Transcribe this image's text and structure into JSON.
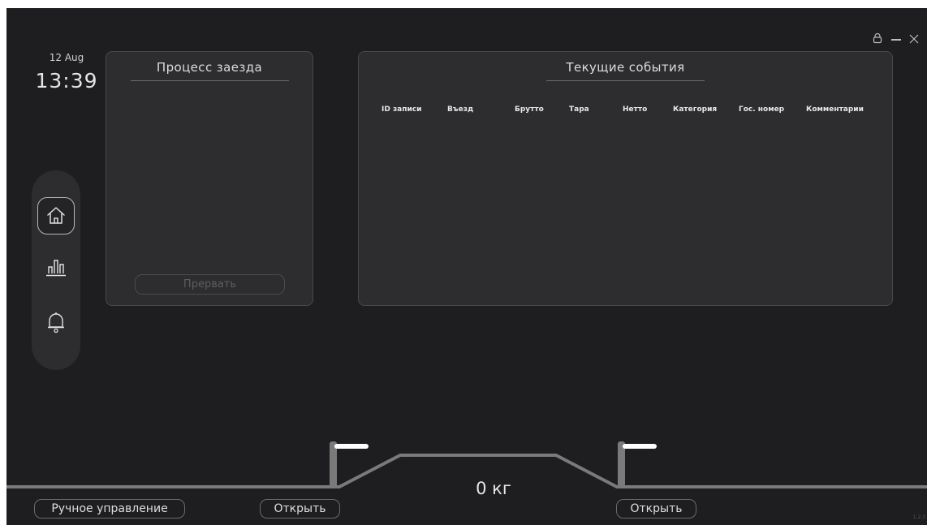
{
  "header": {
    "date": "12 Aug",
    "time": "13:39",
    "window_controls": {
      "lock_icon": "lock-icon",
      "minimize_label": "—",
      "close_label": "×"
    }
  },
  "sidebar": {
    "items": [
      {
        "id": "home",
        "icon": "home-icon",
        "active": true
      },
      {
        "id": "stats",
        "icon": "bar-chart-icon",
        "active": false
      },
      {
        "id": "notifications",
        "icon": "bell-icon",
        "active": false
      }
    ]
  },
  "process_panel": {
    "title": "Процесс заезда",
    "abort_label": "Прервать"
  },
  "events_panel": {
    "title": "Текущие события",
    "columns": [
      "ID записи",
      "Въезд",
      "Брутто",
      "Тара",
      "Нетто",
      "Категория",
      "Гос. номер",
      "Комментарии"
    ],
    "rows": []
  },
  "scale": {
    "weight": "0 кг",
    "manual_control_label": "Ручное управление",
    "left_gate_open_label": "Открыть",
    "right_gate_open_label": "Открыть"
  },
  "colors": {
    "background": "#1e1e20",
    "panel": "#2d2d2f",
    "track": "#7a7a7a",
    "barrier": "#ffffff"
  },
  "version": "1.2.3"
}
